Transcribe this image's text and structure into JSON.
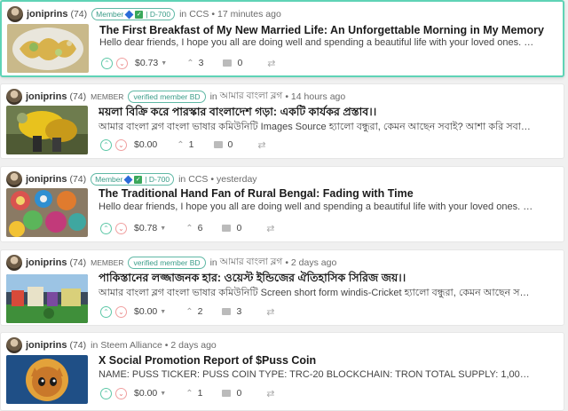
{
  "posts": [
    {
      "author": "joniprins",
      "rep": "(74)",
      "badge_label": "Member",
      "rank": "| D-700",
      "community_prefix": "in",
      "community": "CCS",
      "time": "• 17 minutes ago",
      "title": "The First Breakfast of My New Married Life: An Unforgettable Morning in My Memory",
      "excerpt": "Hello dear friends, I hope you all are doing well and spending a beautiful life with your loved ones. I wish you all...",
      "payout": "$0.73",
      "votes": "3",
      "comments": "0"
    },
    {
      "author": "joniprins",
      "rep": "(74)",
      "member_tag": "MEMBER",
      "verified_label": "verified member BD",
      "community_prefix": "in",
      "community": "আমার বাংলা ব্লগ",
      "time": "• 14 hours ago",
      "title": "ময়লা বিক্রি করে পারস্কার বাংলাদেশ গড়া: একটি কার্যকর প্রস্তাব।।",
      "excerpt": "আমার বাংলা ব্লগ বাংলা ভাষার কমিউনিটি Images Source হ্যালো বন্ধুরা, কেমন আছেন সবাই? আশা করি সবাই ভালো...",
      "payout": "$0.00",
      "votes": "1",
      "comments": "0"
    },
    {
      "author": "joniprins",
      "rep": "(74)",
      "badge_label": "Member",
      "rank": "| D-700",
      "community_prefix": "in",
      "community": "CCS",
      "time": "• yesterday",
      "title": "The Traditional Hand Fan of Rural Bengal: Fading with Time",
      "excerpt": "Hello dear friends, I hope you all are doing well and spending a beautiful life with your loved ones. I wish you all...",
      "payout": "$0.78",
      "votes": "6",
      "comments": "0"
    },
    {
      "author": "joniprins",
      "rep": "(74)",
      "member_tag": "MEMBER",
      "verified_label": "verified member BD",
      "community_prefix": "in",
      "community": "আমার বাংলা ব্লগ",
      "time": "• 2 days ago",
      "title": "পাকিস্তানের লজ্জাজনক হার: ওয়েস্ট ইন্ডিজের ঐতিহাসিক সিরিজ জয়।।",
      "excerpt": "আমার বাংলা ব্লগ বাংলা ভাষার কমিউনিটি Screen short form windis-Cricket হ্যালো বন্ধুরা, কেমন আছেন সবাই? আশা...",
      "payout": "$0.00",
      "votes": "2",
      "comments": "3"
    },
    {
      "author": "joniprins",
      "rep": "(74)",
      "community_prefix": "in",
      "community": "Steem Alliance",
      "time": "• 2 days ago",
      "title": "X Social Promotion Report of $Puss Coin",
      "excerpt": "NAME: PUSS TICKER: PUSS COIN TYPE: TRC-20 BLOCKCHAIN: TRON TOTAL SUPPLY: 1,000,000,000 PUSS website :...",
      "payout": "$0.00",
      "votes": "1",
      "comments": "0"
    }
  ],
  "icons": {
    "upvote": "chevron-up-icon",
    "downvote": "chevron-down-icon",
    "votes": "chevron-up-small-icon",
    "comments": "comment-icon",
    "resteem": "resteem-icon"
  },
  "colors": {
    "accent": "#5fd3b6",
    "upvote": "#5fc8a8",
    "downvote": "#e67c7c"
  }
}
